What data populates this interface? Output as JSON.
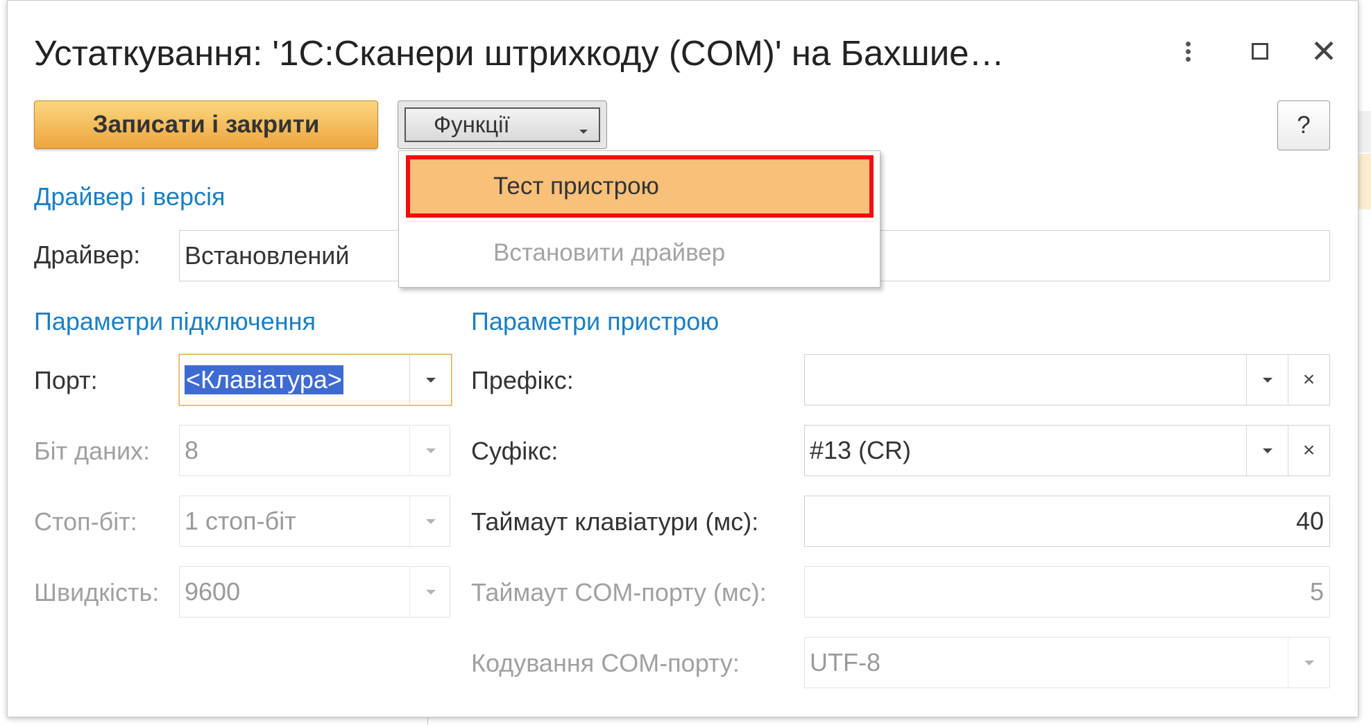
{
  "dialog": {
    "title": "Устаткування: '1С:Сканери штрихкоду (COM)' на Бахшие…"
  },
  "toolbar": {
    "save_close_label": "Записати і закрити",
    "functions_label": "Функції",
    "help_label": "?"
  },
  "functions_menu": {
    "items": [
      {
        "label": "Тест пристрою",
        "highlighted": true,
        "enabled": true
      },
      {
        "label": "Встановити драйвер",
        "highlighted": false,
        "enabled": false
      }
    ]
  },
  "driver_section": {
    "title": "Драйвер і версія",
    "driver_label": "Драйвер:",
    "driver_value": "Встановлений"
  },
  "connection_section": {
    "title": "Параметри підключення",
    "port_label": "Порт:",
    "port_value": "<Клавіатура>",
    "data_bits_label": "Біт даних:",
    "data_bits_value": "8",
    "stop_bits_label": "Стоп-біт:",
    "stop_bits_value": "1 стоп-біт",
    "speed_label": "Швидкість:",
    "speed_value": "9600"
  },
  "device_section": {
    "title": "Параметри пристрою",
    "prefix_label": "Префікс:",
    "prefix_value": "",
    "suffix_label": "Суфікс:",
    "suffix_value": "#13 (CR)",
    "kbd_timeout_label": "Таймаут клавіатури (мс):",
    "kbd_timeout_value": "40",
    "com_timeout_label": "Таймаут COM-порту (мс):",
    "com_timeout_value": "5",
    "com_encoding_label": "Кодування COM-порту:",
    "com_encoding_value": "UTF-8"
  },
  "colors": {
    "accent_blue": "#1a7fc2",
    "primary_button": "#f2b24c",
    "highlight_border": "#f20d0d",
    "selection": "#3d6bd1"
  },
  "icons": {
    "kebab": "more-vertical-icon",
    "maximize": "maximize-icon",
    "close": "close-icon",
    "dropdown": "chevron-down-icon",
    "clear": "clear-icon"
  }
}
